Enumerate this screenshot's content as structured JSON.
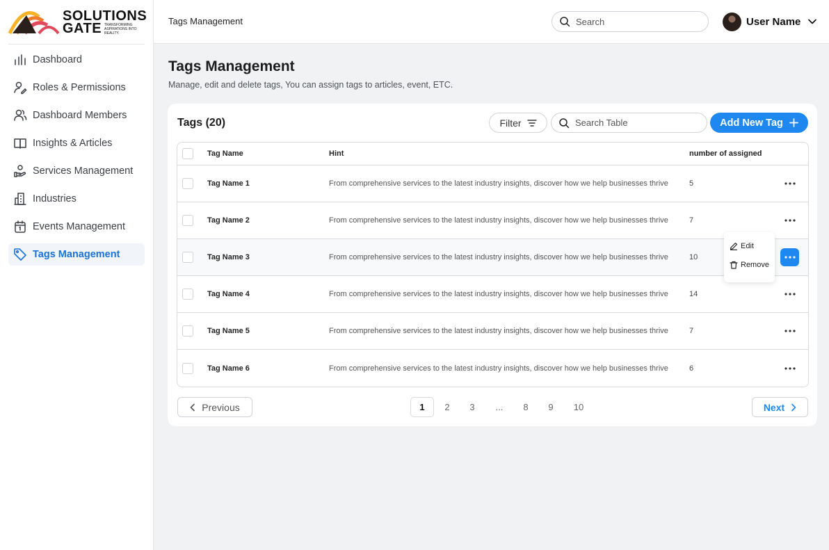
{
  "brand": {
    "line1": "SOLUTIONS",
    "line2": "GATE",
    "tagline": "Transforming aspirations into reality.",
    "colors": [
      "#f7b325",
      "#f07c2e",
      "#e04a5a",
      "#2a1f1b"
    ]
  },
  "sidebar": {
    "items": [
      {
        "label": "Dashboard",
        "icon": "bar-chart-icon",
        "active": false
      },
      {
        "label": "Roles & Permissions",
        "icon": "user-edit-icon",
        "active": false
      },
      {
        "label": "Dashboard Members",
        "icon": "users-icon",
        "active": false
      },
      {
        "label": "Insights & Articles",
        "icon": "book-icon",
        "active": false
      },
      {
        "label": "Services Management",
        "icon": "hand-service-icon",
        "active": false
      },
      {
        "label": "Industries",
        "icon": "building-icon",
        "active": false
      },
      {
        "label": "Events Management",
        "icon": "calendar-icon",
        "active": false
      },
      {
        "label": "Tags Management",
        "icon": "tag-icon",
        "active": true
      }
    ]
  },
  "header": {
    "breadcrumb": "Tags Management",
    "search_placeholder": "Search",
    "user_name": "User Name"
  },
  "page": {
    "title": "Tags Management",
    "subtitle": "Manage, edit and delete tags, You can assign tags to articles, event, ETC."
  },
  "card": {
    "title": "Tags (20)",
    "filter_label": "Filter",
    "search_placeholder": "Search Table",
    "add_label": "Add New Tag"
  },
  "table": {
    "columns": [
      "Tag Name",
      "Hint",
      "number of assigned"
    ],
    "rows": [
      {
        "name": "Tag Name 1",
        "hint": "From comprehensive services to the latest industry insights, discover how we help businesses thrive",
        "count": "5"
      },
      {
        "name": "Tag Name 2",
        "hint": "From comprehensive services to the latest industry insights, discover how we help businesses thrive",
        "count": "7"
      },
      {
        "name": "Tag Name 3",
        "hint": "From comprehensive services to the latest industry insights, discover how we help businesses thrive",
        "count": "10"
      },
      {
        "name": "Tag Name 4",
        "hint": "From comprehensive services to the latest industry insights, discover how we help businesses thrive",
        "count": "14"
      },
      {
        "name": "Tag Name 5",
        "hint": "From comprehensive services to the latest industry insights, discover how we help businesses thrive",
        "count": "7"
      },
      {
        "name": "Tag Name 6",
        "hint": "From comprehensive services to the latest industry insights, discover how we help businesses thrive",
        "count": "6"
      }
    ]
  },
  "row_menu": {
    "edit_label": "Edit",
    "remove_label": "Remove"
  },
  "pagination": {
    "prev_label": "Previous",
    "next_label": "Next",
    "pages": [
      "1",
      "2",
      "3",
      "...",
      "8",
      "9",
      "10"
    ],
    "current": "1"
  },
  "colors": {
    "accent": "#1e88f0",
    "active_nav_text": "#1a73d6"
  }
}
